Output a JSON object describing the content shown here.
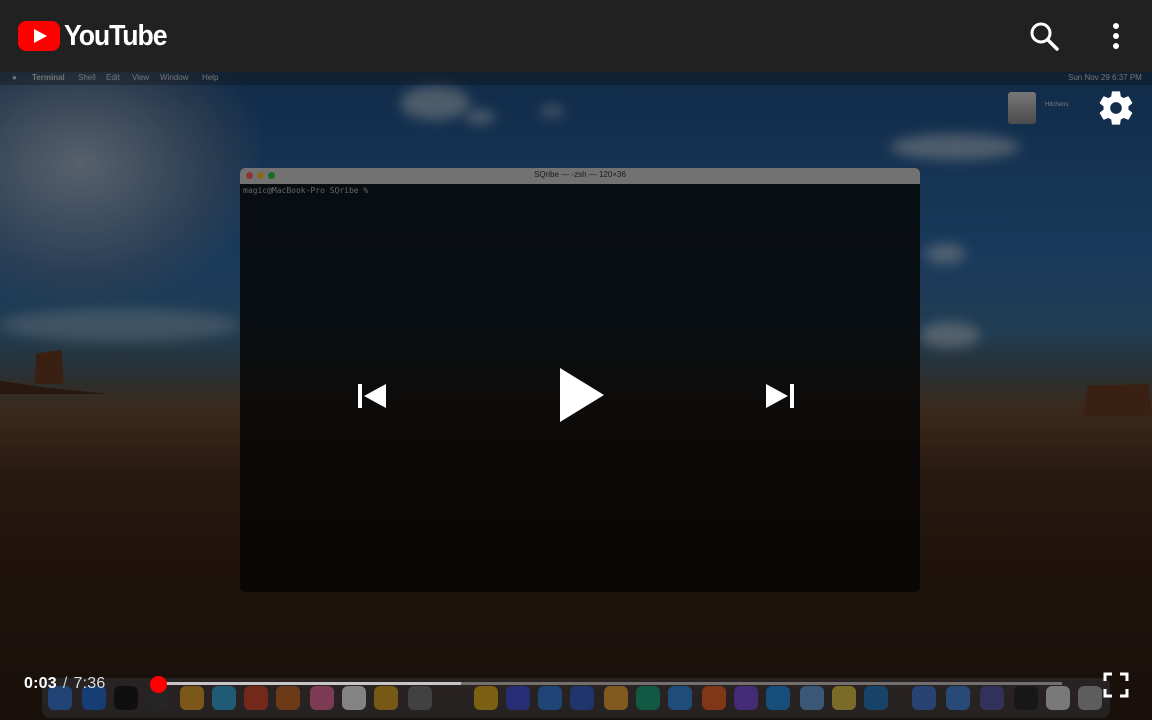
{
  "header": {
    "logo_text": "YouTube",
    "icons": [
      "search-icon",
      "more-vert-icon"
    ]
  },
  "video": {
    "menubar": {
      "app": "Terminal",
      "items": [
        "Shell",
        "Edit",
        "View",
        "Window",
        "Help"
      ],
      "clock": "Sun Nov 29  6:37 PM"
    },
    "terminal": {
      "title": "SQribe — -zsh — 120×36",
      "prompt": "magic@MacBook-Pro SQribe %"
    },
    "disk_label": "Hitchens"
  },
  "player": {
    "current_time": "0:03",
    "separator": "/",
    "duration": "7:36",
    "progress_played_fraction": 0.0066,
    "progress_loaded_fraction": 0.34,
    "accent_color": "#ff0000",
    "icons": [
      "previous-icon",
      "play-icon",
      "next-icon",
      "settings-icon",
      "fullscreen-icon"
    ]
  }
}
